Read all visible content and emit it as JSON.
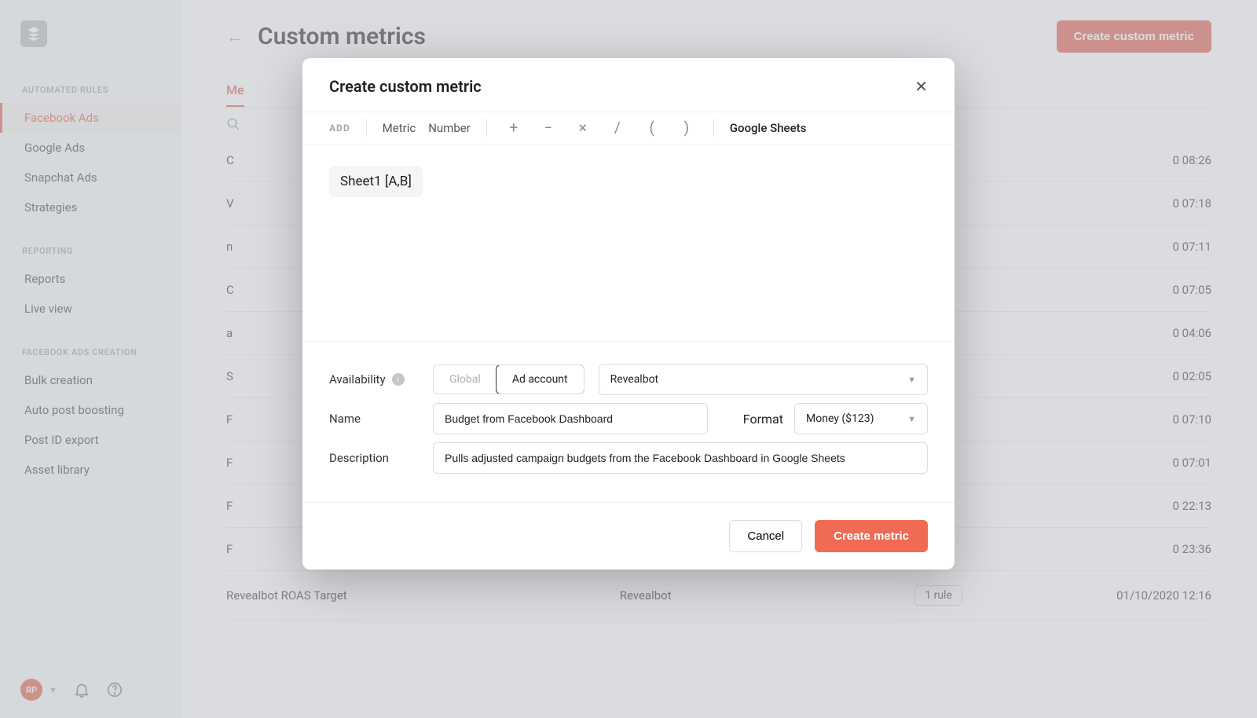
{
  "sidebar": {
    "avatar_initials": "RP",
    "sections": [
      {
        "heading": "AUTOMATED RULES",
        "items": [
          "Facebook Ads",
          "Google Ads",
          "Snapchat Ads",
          "Strategies"
        ],
        "active_index": 0
      },
      {
        "heading": "REPORTING",
        "items": [
          "Reports",
          "Live view"
        ]
      },
      {
        "heading": "FACEBOOK ADS CREATION",
        "items": [
          "Bulk creation",
          "Auto post boosting",
          "Post ID export",
          "Asset library"
        ]
      }
    ]
  },
  "page": {
    "title": "Custom metrics",
    "create_button": "Create custom metric",
    "tab_prefix": "Me"
  },
  "table_rows": [
    {
      "name": "C",
      "date_suffix": "0 08:26"
    },
    {
      "name": "V",
      "date_suffix": "0 07:18"
    },
    {
      "name": "n",
      "date_suffix": "0 07:11"
    },
    {
      "name": "C",
      "date_suffix": "0 07:05"
    },
    {
      "name": "a",
      "date_suffix": "0 04:06"
    },
    {
      "name": "S",
      "date_suffix": "0 02:05"
    },
    {
      "name": "F",
      "date_suffix": "0 07:10"
    },
    {
      "name": "F",
      "date_suffix": "0 07:01"
    },
    {
      "name": "F",
      "date_suffix": "0 22:13"
    },
    {
      "name": "F",
      "date_suffix": "0 23:36"
    }
  ],
  "visible_row": {
    "name": "Revealbot ROAS Target",
    "account": "Revealbot",
    "rule_chip": "1 rule",
    "date": "01/10/2020 12:16"
  },
  "modal": {
    "title": "Create custom metric",
    "toolbar": {
      "add_label": "ADD",
      "metric": "Metric",
      "number": "Number",
      "ops": [
        "+",
        "−",
        "×",
        "/",
        "(",
        ")"
      ],
      "gsheets": "Google Sheets"
    },
    "formula_chip": "Sheet1 [A,B]",
    "availability": {
      "label": "Availability",
      "global": "Global",
      "ad_account": "Ad account",
      "selected_account": "Revealbot"
    },
    "name": {
      "label": "Name",
      "value": "Budget from Facebook Dashboard"
    },
    "format": {
      "label": "Format",
      "value": "Money ($123)"
    },
    "description": {
      "label": "Description",
      "value": "Pulls adjusted campaign budgets from the Facebook Dashboard in Google Sheets"
    },
    "footer": {
      "cancel": "Cancel",
      "create": "Create metric"
    }
  }
}
